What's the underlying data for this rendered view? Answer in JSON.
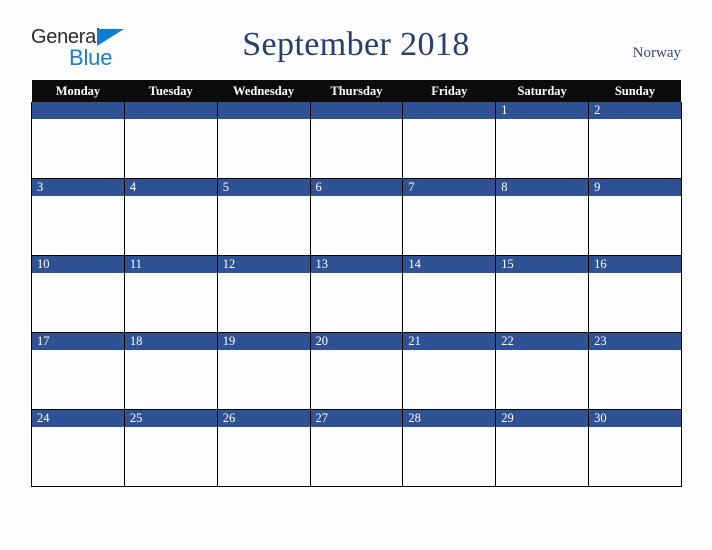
{
  "brand": {
    "name_part1": "General",
    "name_part2": "Blue",
    "triangle_icon": "triangle-icon",
    "color_dark": "#2b2b2b",
    "color_blue": "#1a7fd0"
  },
  "header": {
    "title": "September 2018",
    "country": "Norway",
    "title_color": "#27406b",
    "country_color": "#2e4a76"
  },
  "calendar": {
    "header_bg": "#0b0b0b",
    "header_text_color": "#ffffff",
    "date_bar_color": "#2f5295",
    "date_text_color": "#ffffff",
    "cell_bg": "#fdfdff",
    "grid_line_color": "#000000",
    "weekday_headers": [
      "Monday",
      "Tuesday",
      "Wednesday",
      "Thursday",
      "Friday",
      "Saturday",
      "Sunday"
    ],
    "weeks": [
      [
        "",
        "",
        "",
        "",
        "",
        "1",
        "2"
      ],
      [
        "3",
        "4",
        "5",
        "6",
        "7",
        "8",
        "9"
      ],
      [
        "10",
        "11",
        "12",
        "13",
        "14",
        "15",
        "16"
      ],
      [
        "17",
        "18",
        "19",
        "20",
        "21",
        "22",
        "23"
      ],
      [
        "24",
        "25",
        "26",
        "27",
        "28",
        "29",
        "30"
      ]
    ]
  }
}
